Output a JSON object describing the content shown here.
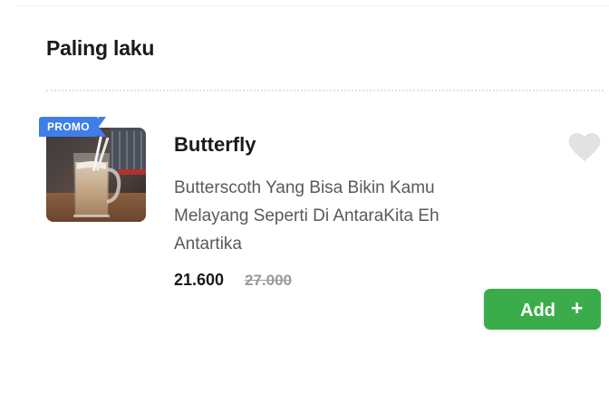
{
  "section": {
    "title": "Paling laku"
  },
  "product": {
    "badge": "PROMO",
    "name": "Butterfly",
    "description": "Butterscoth Yang Bisa Bikin Kamu Melayang Seperti Di AntaraKita Eh Antartika",
    "price": "21.600",
    "original_price": "27.000",
    "favorite_icon": "heart-icon",
    "image_icon": "iced-drink-photo"
  },
  "actions": {
    "add_label": "Add",
    "add_icon": "plus-icon",
    "add_symbol": "+"
  },
  "colors": {
    "accent_green": "#3aad4a",
    "promo_blue": "#3f7ee8",
    "heart_gray": "#e2e2e2",
    "price_old": "#9a9a9a"
  }
}
